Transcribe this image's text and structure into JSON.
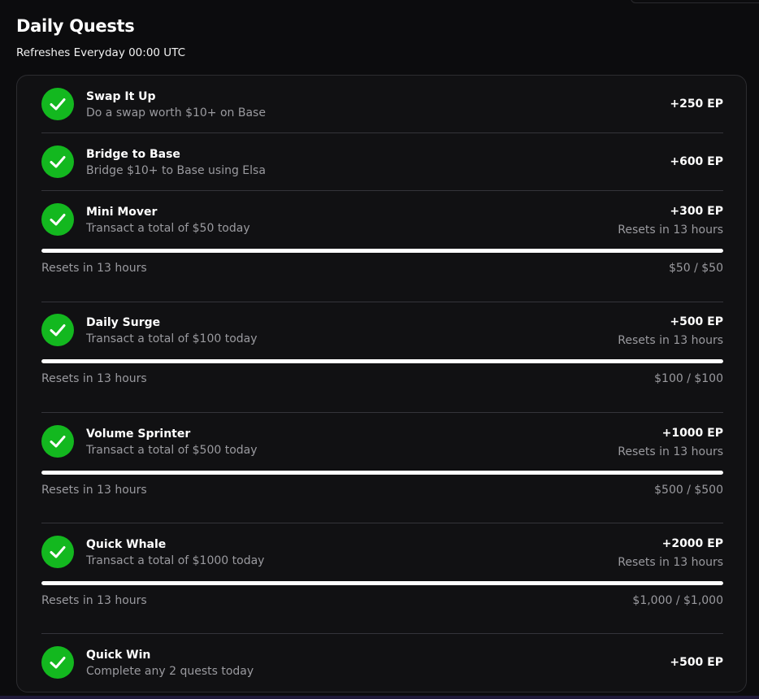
{
  "header": {
    "title": "Daily Quests",
    "subtitle": "Refreshes Everyday 00:00 UTC"
  },
  "colors": {
    "check_green": "#13b81f",
    "background": "#0c0c0e",
    "muted_text": "#9a9a9f"
  },
  "quests": [
    {
      "name": "Swap It Up",
      "description": "Do a swap worth $10+ on Base",
      "reward": "+250 EP",
      "completed": true,
      "icon": "check-icon"
    },
    {
      "name": "Bridge to Base",
      "description": "Bridge $10+ to Base using Elsa",
      "reward": "+600 EP",
      "completed": true,
      "icon": "check-icon"
    },
    {
      "name": "Mini Mover",
      "description": "Transact a total of $50 today",
      "reward": "+300 EP",
      "reset_right": "Resets in 13 hours",
      "reset_left": "Resets in 13 hours",
      "progress_text": "$50 / $50",
      "progress": 1.0,
      "completed": true,
      "icon": "check-icon"
    },
    {
      "name": "Daily Surge",
      "description": "Transact a total of $100 today",
      "reward": "+500 EP",
      "reset_right": "Resets in 13 hours",
      "reset_left": "Resets in 13 hours",
      "progress_text": "$100 / $100",
      "progress": 1.0,
      "completed": true,
      "icon": "check-icon"
    },
    {
      "name": "Volume Sprinter",
      "description": "Transact a total of $500 today",
      "reward": "+1000 EP",
      "reset_right": "Resets in 13 hours",
      "reset_left": "Resets in 13 hours",
      "progress_text": "$500 / $500",
      "progress": 1.0,
      "completed": true,
      "icon": "check-icon"
    },
    {
      "name": "Quick Whale",
      "description": "Transact a total of $1000 today",
      "reward": "+2000 EP",
      "reset_right": "Resets in 13 hours",
      "reset_left": "Resets in 13 hours",
      "progress_text": "$1,000 / $1,000",
      "progress": 1.0,
      "completed": true,
      "icon": "check-icon"
    },
    {
      "name": "Quick Win",
      "description": "Complete any 2 quests today",
      "reward": "+500 EP",
      "completed": true,
      "icon": "check-icon"
    }
  ]
}
